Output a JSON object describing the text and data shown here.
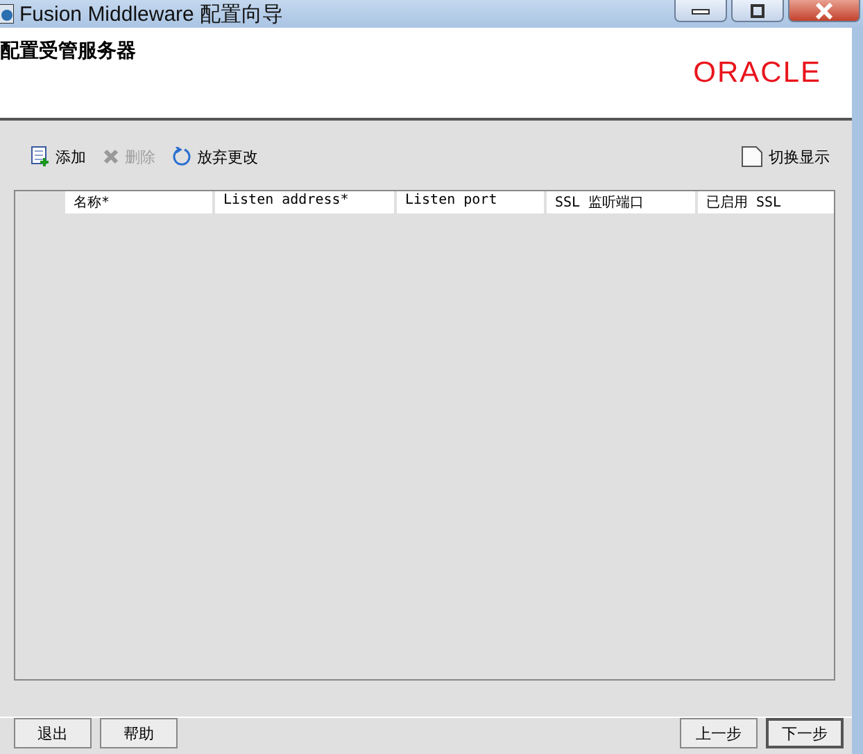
{
  "window": {
    "title": "Fusion Middleware 配置向导"
  },
  "header": {
    "title": "配置受管服务器",
    "logo": "ORACLE"
  },
  "toolbar": [
    {
      "kind": "add",
      "label": "添加",
      "disabled": false
    },
    {
      "kind": "delete",
      "label": "删除",
      "disabled": true
    },
    {
      "kind": "revert",
      "label": "放弃更改",
      "disabled": false
    }
  ],
  "toggle": {
    "label": "切换显示"
  },
  "table": {
    "columns": [
      "名称*",
      "Listen address*",
      "Listen port",
      "SSL 监听端口",
      "已启用 SSL"
    ]
  },
  "left_buttons": [
    {
      "label": "退出",
      "default": false
    },
    {
      "label": "帮助",
      "default": false
    }
  ],
  "right_buttons": [
    {
      "label": "上一步",
      "default": false
    },
    {
      "label": "下一步",
      "default": true
    }
  ]
}
